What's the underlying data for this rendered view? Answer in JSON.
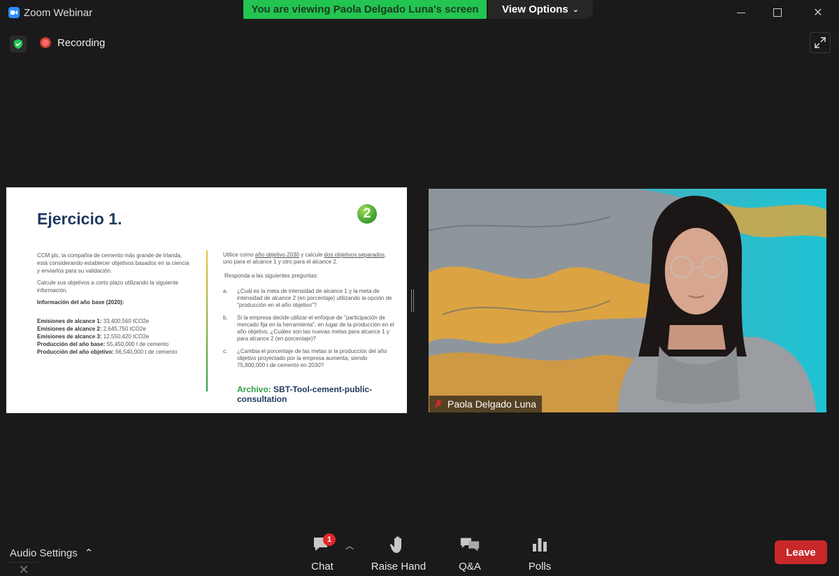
{
  "window": {
    "title": "Zoom Webinar",
    "share_banner": "You are viewing Paola Delgado Luna's screen",
    "view_options": "View Options"
  },
  "status": {
    "recording_label": "Recording"
  },
  "slide": {
    "title": "Ejercicio 1.",
    "badge": "2",
    "left": {
      "p1": "CCM plc, la compañía de cemento más grande de Irlanda, está considerando establecer objetivos basados en la ciencia y enviarlos para su validación.",
      "p2": "Calcule sus objetivos a corto plazo utilizando la siguiente información.",
      "info_head": "Información del año base (2020):",
      "items": [
        {
          "label": "Emisiones de alcance 1:",
          "value": " 33,400,560 tCO2e"
        },
        {
          "label": "Emisiones de alcance 2:",
          "value": " 2,645,750 tCO2e"
        },
        {
          "label": "Emisiones de alcance 3:",
          "value": " 12,550,420 tCO2e"
        },
        {
          "label": "Producción del año base:",
          "value": " 55,450,000 t de cemento"
        },
        {
          "label": "Producción del año objetivo:",
          "value": " 66,540,000 t de cemento"
        }
      ]
    },
    "right": {
      "intro_a": "Utilice como ",
      "intro_u1": "año objetivo 2030",
      "intro_b": " y calcule ",
      "intro_u2": "dos objetivos separados",
      "intro_c": ", uno para el alcance 1 y otro para el alcance 2.",
      "respond": "Responda a las siguientes preguntas:",
      "questions": [
        {
          "letter": "a.",
          "text": "¿Cuál es la meta de intensidad de alcance 1 y la meta de intensidad de alcance 2 (en porcentaje) utilizando la opción de \"producción en el año objetivo\"?"
        },
        {
          "letter": "b.",
          "text": "Si la empresa decide utilizar el enfoque de \"participación de mercado fija en la herramienta\", en lugar de la producción en el año objetivo, ¿Cuáles son las nuevas metas para alcance 1 y para alcance 2 (en porcentaje)?"
        },
        {
          "letter": "c.",
          "text": "¿Cambia el porcentaje de las metas si la producción del año objetivo proyectado por la empresa aumenta, siendo 75,800,000 t de cemento en 2030?"
        }
      ]
    },
    "file_label": "Archivo:",
    "file_name": " SBT-Tool-cement-public-consultation"
  },
  "video": {
    "participant_name": "Paola Delgado Luna"
  },
  "toolbar": {
    "audio_settings": "Audio Settings",
    "chat_label": "Chat",
    "chat_badge": "1",
    "raise_hand_label": "Raise Hand",
    "qa_label": "Q&A",
    "polls_label": "Polls",
    "leave_label": "Leave"
  },
  "colors": {
    "share_banner": "#23c552",
    "leave": "#c8282a",
    "badge": "#e02828",
    "slide_title": "#1e3a5f",
    "slide_accent": "#2e9e44"
  },
  "icons": [
    "zoom-app-icon",
    "minimize-icon",
    "maximize-icon",
    "close-icon",
    "shield-check-icon",
    "record-icon",
    "fullscreen-icon",
    "mic-off-icon",
    "chevron-up-icon",
    "chat-icon",
    "hand-icon",
    "qa-icon",
    "polls-icon"
  ]
}
